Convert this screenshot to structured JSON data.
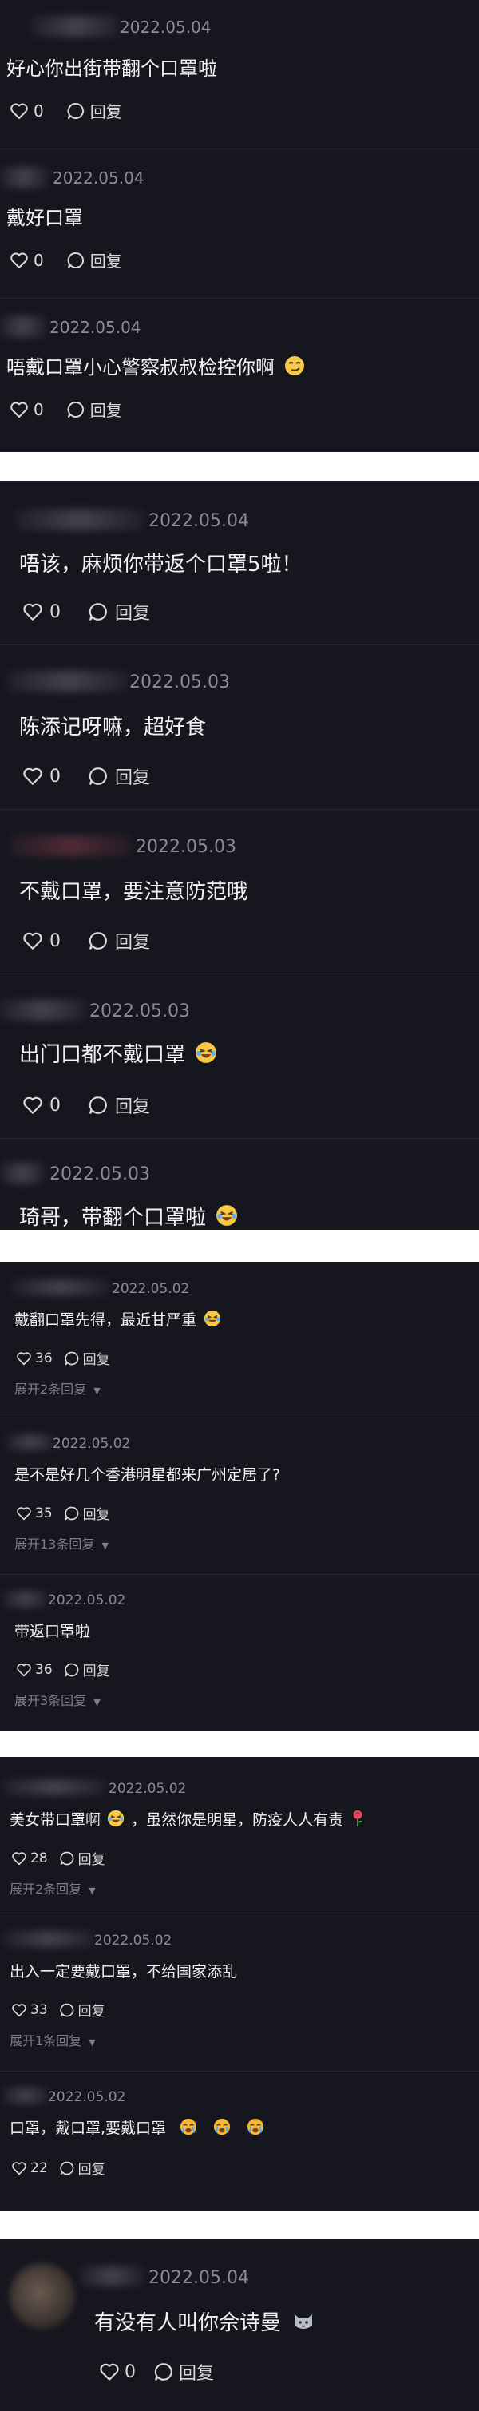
{
  "panel1": {
    "comments": [
      {
        "date": "2022.05.04",
        "text": "好心你出街带翻个口罩啦",
        "likes": "0",
        "reply": "回复"
      },
      {
        "date": "2022.05.04",
        "text": "戴好口罩",
        "likes": "0",
        "reply": "回复"
      },
      {
        "date": "2022.05.04",
        "text": "唔戴口罩小心警察叔叔检控你啊",
        "likes": "0",
        "reply": "回复"
      }
    ]
  },
  "panel2": {
    "comments": [
      {
        "date": "2022.05.04",
        "text": "唔该，麻烦你带返个口罩5啦！",
        "likes": "0",
        "reply": "回复"
      },
      {
        "date": "2022.05.03",
        "text": "陈添记呀嘛，超好食",
        "likes": "0",
        "reply": "回复"
      },
      {
        "date": "2022.05.03",
        "text": "不戴口罩，要注意防范哦",
        "likes": "0",
        "reply": "回复"
      },
      {
        "date": "2022.05.03",
        "text": "出门口都不戴口罩",
        "likes": "0",
        "reply": "回复"
      },
      {
        "date": "2022.05.03",
        "text": "琦哥，带翻个口罩啦"
      }
    ]
  },
  "panel3": {
    "comments": [
      {
        "date": "2022.05.02",
        "text": "戴翻口罩先得，最近甘严重",
        "likes": "36",
        "reply": "回复",
        "expand": "展开2条回复"
      },
      {
        "date": "2022.05.02",
        "text": "是不是好几个香港明星都来广州定居了?",
        "likes": "35",
        "reply": "回复",
        "expand": "展开13条回复"
      },
      {
        "date": "2022.05.02",
        "text": "带返口罩啦",
        "likes": "36",
        "reply": "回复",
        "expand": "展开3条回复"
      }
    ]
  },
  "panel4": {
    "comments": [
      {
        "date": "2022.05.02",
        "text_a": "美女带口罩啊",
        "text_b": "，虽然你是明星，防疫人人有责",
        "likes": "28",
        "reply": "回复",
        "expand": "展开2条回复"
      },
      {
        "date": "2022.05.02",
        "text": "出入一定要戴口罩，不给国家添乱",
        "likes": "33",
        "reply": "回复",
        "expand": "展开1条回复"
      },
      {
        "date": "2022.05.02",
        "text": "口罩，戴口罩,要戴口罩",
        "likes": "22",
        "reply": "回复"
      }
    ]
  },
  "panel5": {
    "comments": [
      {
        "date": "2022.05.04",
        "text": "有没有人叫你佘诗曼",
        "likes": "0",
        "reply": "回复"
      }
    ]
  },
  "colors": {
    "panel_bg": "#16161f",
    "text": "#f2f2f4",
    "muted": "#8b8c93"
  }
}
